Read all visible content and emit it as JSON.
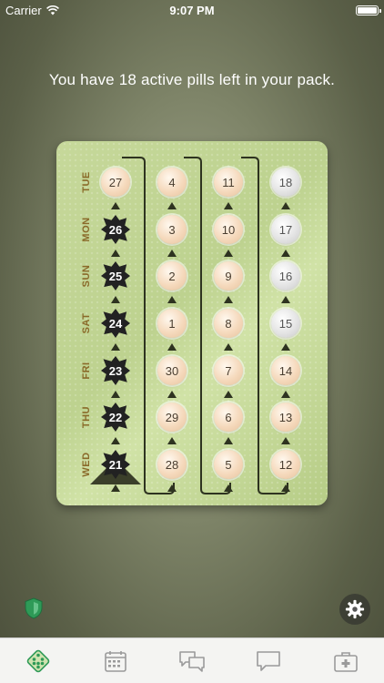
{
  "status_bar": {
    "carrier": "Carrier",
    "time": "9:07 PM"
  },
  "headline": "You have 18 active pills left in your pack.",
  "pack": {
    "day_labels": [
      "TUE",
      "MON",
      "SUN",
      "SAT",
      "FRI",
      "THU",
      "WED"
    ],
    "columns": [
      {
        "pills": [
          {
            "num": "27",
            "state": "active"
          },
          {
            "num": "26",
            "state": "taken"
          },
          {
            "num": "25",
            "state": "taken"
          },
          {
            "num": "24",
            "state": "taken"
          },
          {
            "num": "23",
            "state": "taken"
          },
          {
            "num": "22",
            "state": "taken"
          },
          {
            "num": "21",
            "state": "taken"
          }
        ]
      },
      {
        "pills": [
          {
            "num": "4",
            "state": "active"
          },
          {
            "num": "3",
            "state": "active"
          },
          {
            "num": "2",
            "state": "active"
          },
          {
            "num": "1",
            "state": "active"
          },
          {
            "num": "30",
            "state": "active"
          },
          {
            "num": "29",
            "state": "active"
          },
          {
            "num": "28",
            "state": "active"
          }
        ]
      },
      {
        "pills": [
          {
            "num": "11",
            "state": "active"
          },
          {
            "num": "10",
            "state": "active"
          },
          {
            "num": "9",
            "state": "active"
          },
          {
            "num": "8",
            "state": "active"
          },
          {
            "num": "7",
            "state": "active"
          },
          {
            "num": "6",
            "state": "active"
          },
          {
            "num": "5",
            "state": "active"
          }
        ]
      },
      {
        "pills": [
          {
            "num": "18",
            "state": "placebo"
          },
          {
            "num": "17",
            "state": "placebo"
          },
          {
            "num": "16",
            "state": "placebo"
          },
          {
            "num": "15",
            "state": "placebo"
          },
          {
            "num": "14",
            "state": "active"
          },
          {
            "num": "13",
            "state": "active"
          },
          {
            "num": "12",
            "state": "active"
          }
        ]
      }
    ]
  },
  "icons": {
    "shield": "shield-icon",
    "settings": "gear-icon",
    "tabs": [
      "pill-pack-icon",
      "calendar-icon",
      "chat-bubbles-icon",
      "speech-bubble-icon",
      "first-aid-kit-icon"
    ]
  },
  "colors": {
    "accent": "#2e9a57",
    "card": "#c6d89a",
    "active_pill": "#f5d9bc",
    "placebo_pill": "#e4e4e4",
    "taken_pill": "#222222",
    "day_label": "#8a6a2a"
  }
}
